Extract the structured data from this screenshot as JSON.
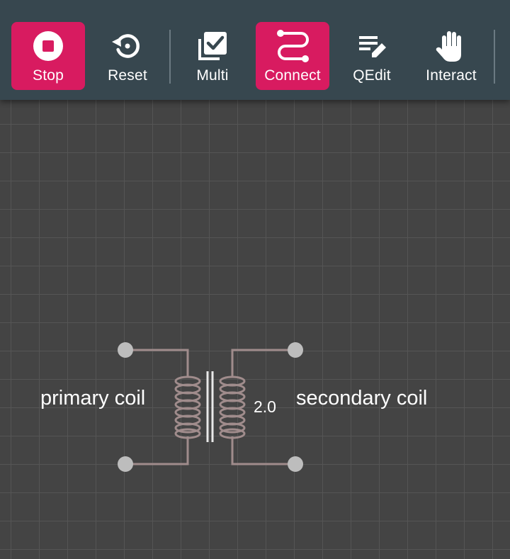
{
  "toolbar": {
    "buttons": [
      {
        "id": "stop",
        "label": "Stop",
        "icon": "stop-icon",
        "active": true
      },
      {
        "id": "reset",
        "label": "Reset",
        "icon": "reset-icon",
        "active": false
      },
      {
        "id": "multi",
        "label": "Multi",
        "icon": "multi-select-icon",
        "active": false
      },
      {
        "id": "connect",
        "label": "Connect",
        "icon": "connect-icon",
        "active": true
      },
      {
        "id": "qedit",
        "label": "QEdit",
        "icon": "quick-edit-icon",
        "active": false
      },
      {
        "id": "interact",
        "label": "Interact",
        "icon": "hand-icon",
        "active": false
      }
    ],
    "colors": {
      "background": "#37474f",
      "accent": "#d81b60"
    }
  },
  "circuit": {
    "component": "transformer",
    "primary_label": "primary coil",
    "secondary_label": "secondary coil",
    "ratio": "2.0",
    "colors": {
      "wire": "#a08c8c",
      "terminal": "#bdbdbd",
      "core": "#e8e8e8"
    }
  }
}
